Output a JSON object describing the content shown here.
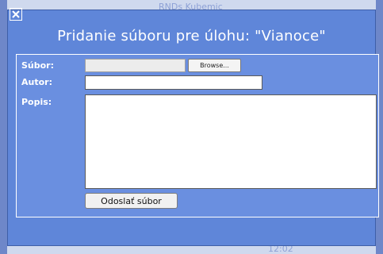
{
  "background": {
    "title_fragment": "RNDs Kubemic",
    "time": "12:02"
  },
  "dialog": {
    "close_icon": "close-icon",
    "title": "Pridanie súboru pre úlohu: \"Vianoce\"",
    "form": {
      "file_label": "Súbor:",
      "browse_label": "Browse...",
      "author_label": "Autor:",
      "author_value": "",
      "description_label": "Popis:",
      "description_value": "",
      "submit_label": "Odoslať súbor"
    }
  },
  "colors": {
    "dialog_bg": "#5f86d9",
    "panel_bg": "#6a8fe0",
    "text": "#ffffff"
  }
}
